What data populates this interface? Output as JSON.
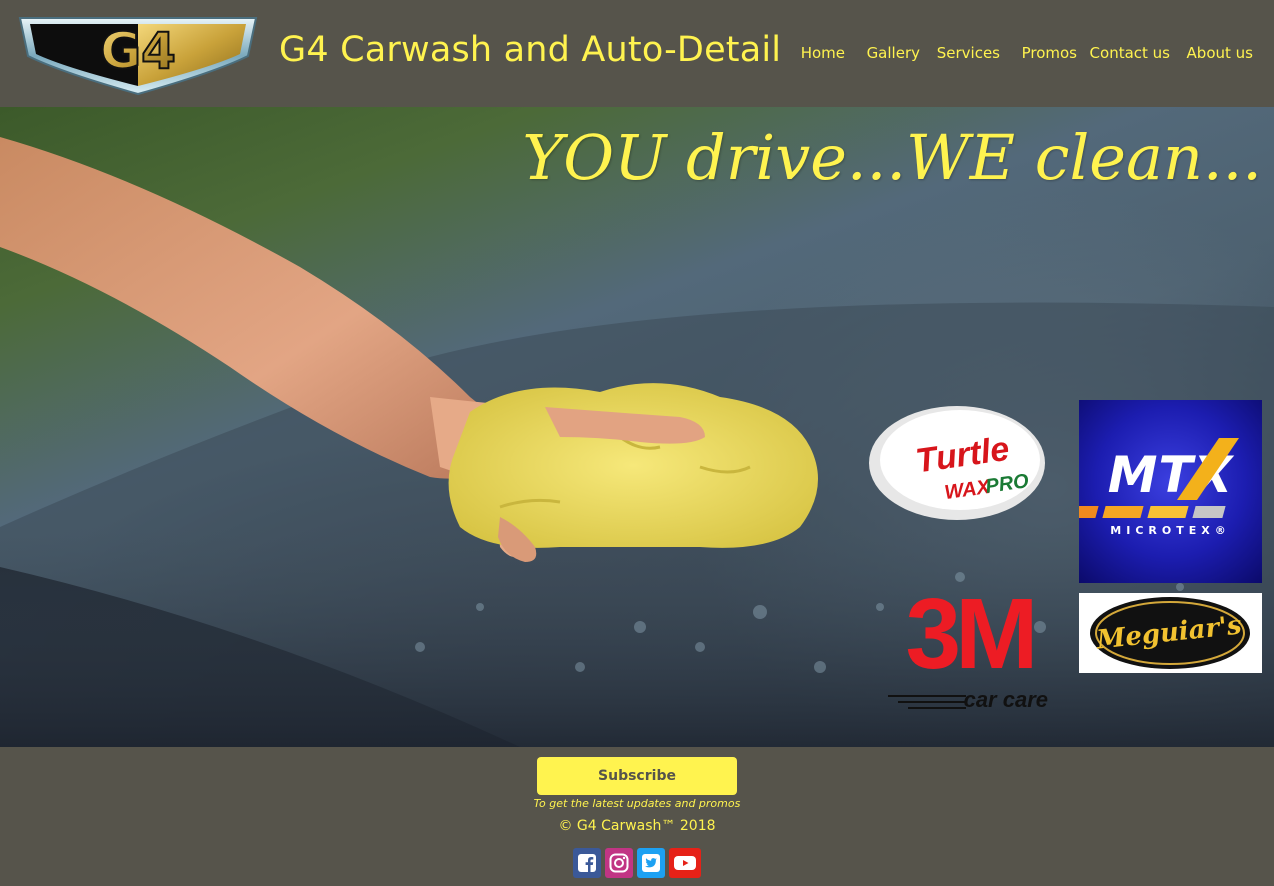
{
  "header": {
    "logo_text": "G4",
    "title": "G4 Carwash and Auto-Detail",
    "nav": [
      "Home",
      "Gallery",
      "Services",
      "Promos",
      "Contact us",
      "About us"
    ]
  },
  "hero": {
    "tagline": "YOU drive...WE clean...",
    "brands": {
      "turtle": "Turtle Wax Pro",
      "mtx": "MTX",
      "mtx_sub": "MICROTEX®",
      "three_m": "3M",
      "three_m_sub": "car care",
      "meguiars": "Meguiar's"
    }
  },
  "footer": {
    "subscribe_label": "Subscribe",
    "subscribe_note": "To get the latest updates and promos",
    "copyright": "© G4 Carwash™ 2018",
    "social": [
      {
        "icon": "facebook-icon",
        "color": "#3b5998"
      },
      {
        "icon": "instagram-icon",
        "color": "#c13584"
      },
      {
        "icon": "twitter-icon",
        "color": "#1da1f2"
      },
      {
        "icon": "youtube-icon",
        "color": "#e62117"
      }
    ]
  },
  "colors": {
    "background": "#56544b",
    "accent": "#fff34f"
  }
}
